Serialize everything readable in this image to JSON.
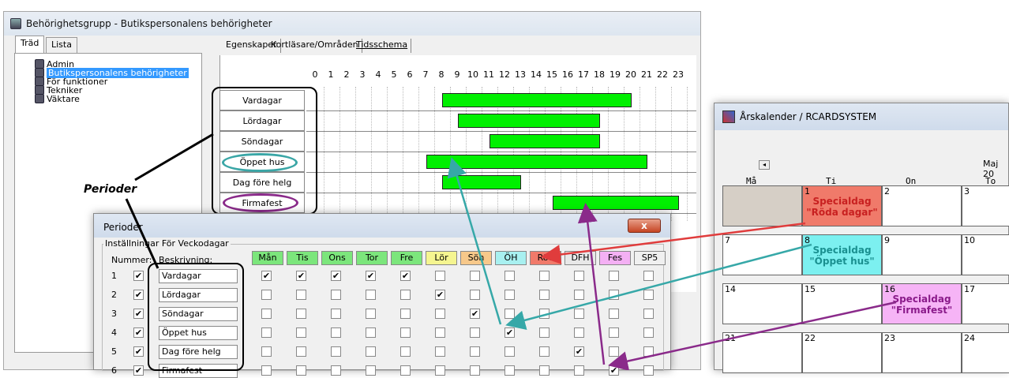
{
  "main_window": {
    "title": "Behörighetsgrupp - Butikspersonalens behörigheter",
    "tabs": [
      {
        "label": "Träd"
      },
      {
        "label": "Lista"
      }
    ],
    "tree": [
      "Admin",
      "Butikspersonalens behörigheter",
      "För funktioner",
      "Tekniker",
      "Väktare"
    ],
    "right_tabs": [
      {
        "label": "Egenskaper"
      },
      {
        "label": "Kortläsare/Områden"
      },
      {
        "label": "Tidsschema"
      }
    ],
    "hours": [
      "0",
      "1",
      "2",
      "3",
      "4",
      "5",
      "6",
      "7",
      "8",
      "9",
      "10",
      "11",
      "12",
      "13",
      "14",
      "15",
      "16",
      "17",
      "18",
      "19",
      "20",
      "21",
      "22",
      "23"
    ],
    "periods": [
      {
        "label": "Vardagar",
        "start": 9,
        "end": 21
      },
      {
        "label": "Lördagar",
        "start": 10,
        "end": 19
      },
      {
        "label": "Söndagar",
        "start": 12,
        "end": 19
      },
      {
        "label": "Öppet hus",
        "start": 8,
        "end": 22
      },
      {
        "label": "Dag före helg",
        "start": 9,
        "end": 14
      },
      {
        "label": "Firmafest",
        "start": 16,
        "end": 24
      }
    ]
  },
  "annotation": {
    "perioder": "Perioder"
  },
  "dialog": {
    "title": "Perioder",
    "close": "x",
    "legend": "Inställningar För Veckodagar",
    "num_header": "Nummer:",
    "desc_header": "Beskrivning:",
    "days": [
      {
        "label": "Mån",
        "color": "#7ce67c"
      },
      {
        "label": "Tis",
        "color": "#7ce67c"
      },
      {
        "label": "Ons",
        "color": "#7ce67c"
      },
      {
        "label": "Tor",
        "color": "#7ce67c"
      },
      {
        "label": "Fre",
        "color": "#7ce67c"
      },
      {
        "label": "Lör",
        "color": "#f5f590"
      },
      {
        "label": "Sön",
        "color": "#f7c88a"
      },
      {
        "label": "ÖH",
        "color": "#a8f0f0"
      },
      {
        "label": "Röd",
        "color": "#f07a6a"
      },
      {
        "label": "DFH",
        "color": "#e8e8e8"
      },
      {
        "label": "Fes",
        "color": "#f4b0f4"
      },
      {
        "label": "SP5",
        "color": "#f0f0f0"
      }
    ],
    "rows": [
      {
        "num": "1",
        "desc": "Vardagar",
        "checks": [
          1,
          1,
          1,
          1,
          1,
          0,
          0,
          0,
          0,
          0,
          0,
          0
        ]
      },
      {
        "num": "2",
        "desc": "Lördagar",
        "checks": [
          0,
          0,
          0,
          0,
          0,
          1,
          0,
          0,
          0,
          0,
          0,
          0
        ]
      },
      {
        "num": "3",
        "desc": "Söndagar",
        "checks": [
          0,
          0,
          0,
          0,
          0,
          0,
          1,
          0,
          0,
          0,
          0,
          0
        ]
      },
      {
        "num": "4",
        "desc": "Öppet hus",
        "checks": [
          0,
          0,
          0,
          0,
          0,
          0,
          0,
          1,
          0,
          0,
          0,
          0
        ]
      },
      {
        "num": "5",
        "desc": "Dag före helg",
        "checks": [
          0,
          0,
          0,
          0,
          0,
          0,
          0,
          0,
          0,
          1,
          0,
          0
        ]
      },
      {
        "num": "6",
        "desc": "Firmafest",
        "checks": [
          0,
          0,
          0,
          0,
          0,
          0,
          0,
          0,
          0,
          0,
          1,
          0
        ]
      }
    ]
  },
  "calendar": {
    "title": "Årskalender / RCARDSYSTEM",
    "month": "Maj 20",
    "weekdays": [
      "Må",
      "Ti",
      "On",
      "To"
    ],
    "cells": [
      {
        "n": "",
        "r": 0,
        "c": 0,
        "bg": "#d6cfc6"
      },
      {
        "n": "1",
        "r": 0,
        "c": 1,
        "bg": "#f07a6a",
        "l1": "Specialdag",
        "l2": "\"Röda dagar\"",
        "fg": "#c82020"
      },
      {
        "n": "2",
        "r": 0,
        "c": 2
      },
      {
        "n": "3",
        "r": 0,
        "c": 3
      },
      {
        "n": "7",
        "r": 1,
        "c": 0
      },
      {
        "n": "8",
        "r": 1,
        "c": 1,
        "bg": "#7cf0f0",
        "l1": "Specialdag",
        "l2": "\"Öppet hus\"",
        "fg": "#1a9090"
      },
      {
        "n": "9",
        "r": 1,
        "c": 2
      },
      {
        "n": "10",
        "r": 1,
        "c": 3
      },
      {
        "n": "14",
        "r": 2,
        "c": 0
      },
      {
        "n": "15",
        "r": 2,
        "c": 1
      },
      {
        "n": "16",
        "r": 2,
        "c": 2,
        "bg": "#f6b4f6",
        "l1": "Specialdag",
        "l2": "\"Firmafest\"",
        "fg": "#8a1a8a"
      },
      {
        "n": "17",
        "r": 2,
        "c": 3
      },
      {
        "n": "21",
        "r": 3,
        "c": 0
      },
      {
        "n": "22",
        "r": 3,
        "c": 1
      },
      {
        "n": "23",
        "r": 3,
        "c": 2
      },
      {
        "n": "24",
        "r": 3,
        "c": 3
      }
    ]
  }
}
